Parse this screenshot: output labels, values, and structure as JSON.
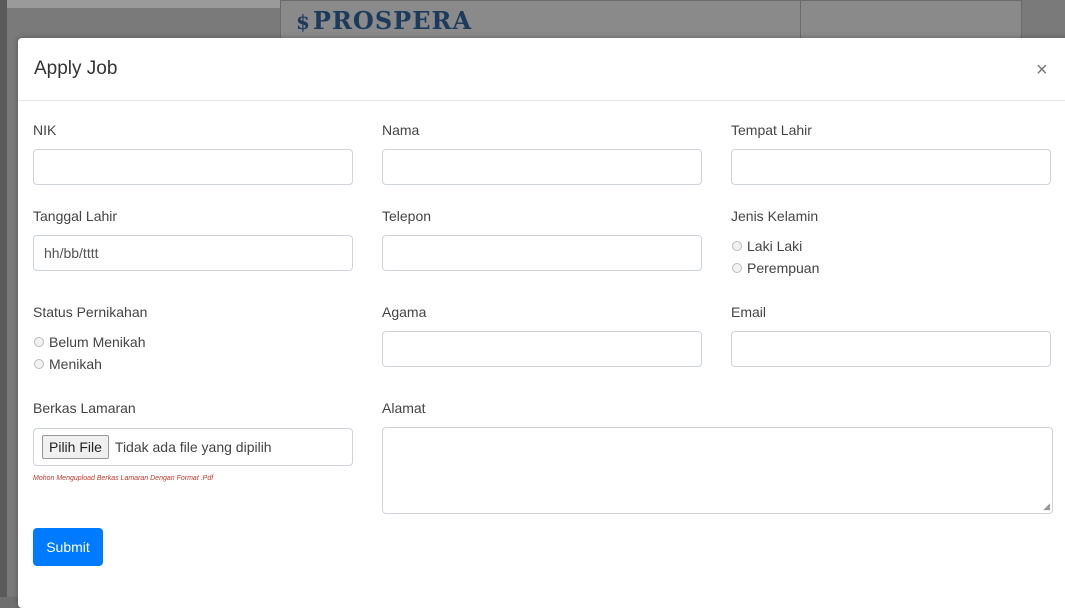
{
  "background": {
    "logo_text": "PROSPERA",
    "logo_icon": "dollar-shield-icon"
  },
  "modal": {
    "title": "Apply Job",
    "close_symbol": "×"
  },
  "fields": {
    "nik": {
      "label": "NIK",
      "value": "",
      "placeholder": ""
    },
    "nama": {
      "label": "Nama",
      "value": "",
      "placeholder": ""
    },
    "tempat_lahir": {
      "label": "Tempat Lahir",
      "value": "",
      "placeholder": ""
    },
    "tanggal_lahir": {
      "label": "Tanggal Lahir",
      "value": "hh/bb/tttt"
    },
    "telepon": {
      "label": "Telepon",
      "value": ""
    },
    "jenis_kelamin": {
      "label": "Jenis Kelamin",
      "options": [
        "Laki Laki",
        "Perempuan"
      ]
    },
    "status_pernikahan": {
      "label": "Status Pernikahan",
      "options": [
        "Belum Menikah",
        "Menikah"
      ]
    },
    "agama": {
      "label": "Agama",
      "value": ""
    },
    "email": {
      "label": "Email",
      "value": ""
    },
    "berkas_lamaran": {
      "label": "Berkas Lamaran",
      "button_label": "Pilih File",
      "status": "Tidak ada file yang dipilih",
      "hint": "Mohon Mengupload Berkas Lamaran Dengan Format .Pdf"
    },
    "alamat": {
      "label": "Alamat",
      "value": ""
    }
  },
  "submit_label": "Submit",
  "colors": {
    "primary": "#007bff",
    "hint": "#c0392b"
  }
}
